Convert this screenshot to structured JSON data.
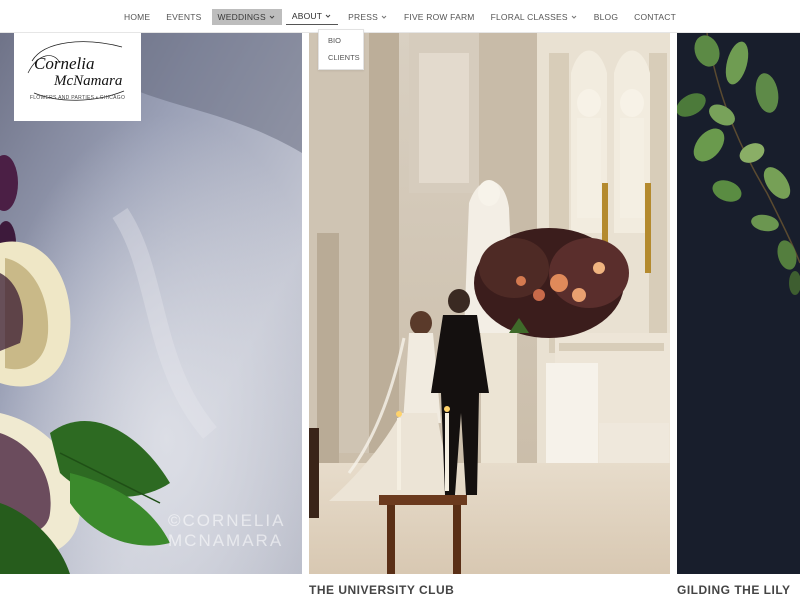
{
  "nav": {
    "items": [
      {
        "label": "HOME",
        "has_chevron": false
      },
      {
        "label": "EVENTS",
        "has_chevron": false
      },
      {
        "label": "WEDDINGS",
        "has_chevron": true
      },
      {
        "label": "ABOUT",
        "has_chevron": true
      },
      {
        "label": "PRESS",
        "has_chevron": true
      },
      {
        "label": "FIVE ROW FARM",
        "has_chevron": false
      },
      {
        "label": "FLORAL CLASSES",
        "has_chevron": true
      },
      {
        "label": "BLOG",
        "has_chevron": false
      },
      {
        "label": "CONTACT",
        "has_chevron": false
      }
    ],
    "highlighted_item": "WEDDINGS",
    "open_menu": "ABOUT",
    "dropdown_items": [
      "BIO",
      "CLIENTS"
    ]
  },
  "logo": {
    "line1": "Cornelia",
    "line2": "McNamara",
    "tagline": "FLOWERS AND PARTIES • CHICAGO"
  },
  "gallery": {
    "watermark_line1": "©CORNELIA",
    "watermark_line2": "MCNAMARA",
    "captions": {
      "center": "THE UNIVERSITY CLUB",
      "right": "GILDING THE LILY"
    }
  },
  "colors": {
    "nav_text": "#555555",
    "nav_highlight_bg": "#bdbdbd",
    "caption_text": "#444444",
    "right_panel_bg": "#141a26"
  }
}
